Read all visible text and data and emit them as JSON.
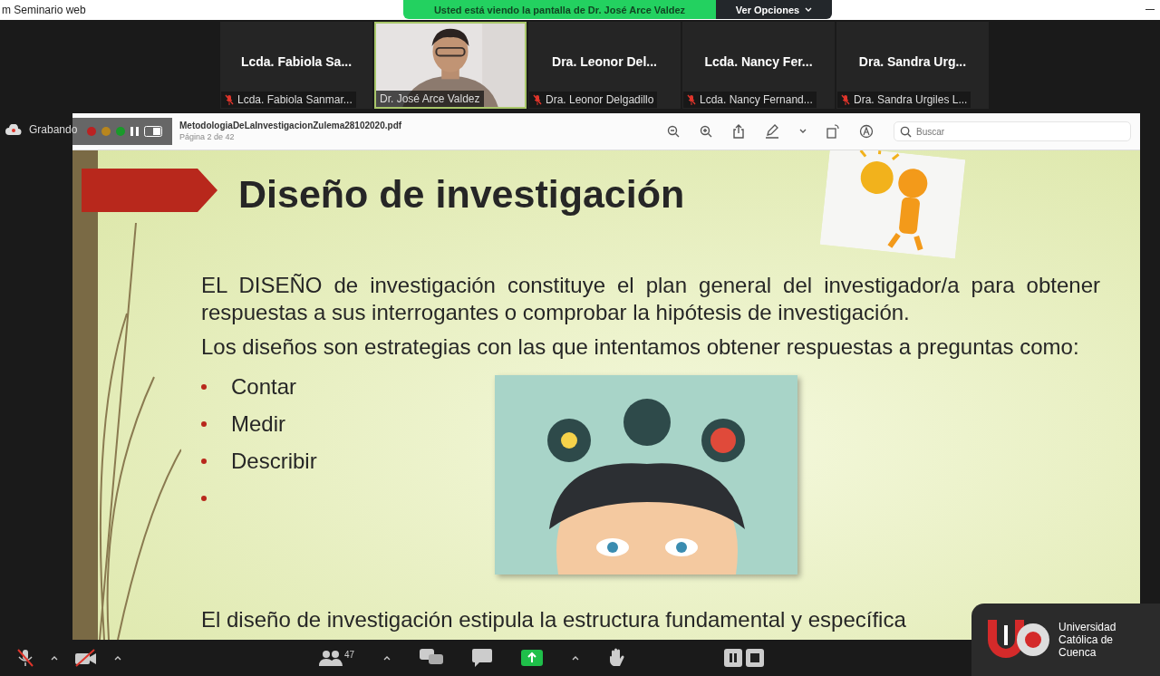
{
  "window": {
    "title": "m Seminario web"
  },
  "share_banner": {
    "text": "Usted está viendo la pantalla de Dr. José Arce Valdez",
    "options_button": "Ver Opciones"
  },
  "participants": [
    {
      "kind": "name",
      "display": "Lcda. Fabiola Sa...",
      "label": "Lcda. Fabiola Sanmar...",
      "muted": true,
      "speaking": false
    },
    {
      "kind": "video",
      "label": "Dr. José Arce Valdez",
      "muted": false,
      "speaking": true
    },
    {
      "kind": "name",
      "display": "Dra. Leonor Del...",
      "label": "Dra. Leonor Delgadillo",
      "muted": true,
      "speaking": false
    },
    {
      "kind": "name",
      "display": "Lcda. Nancy Fer...",
      "label": "Lcda. Nancy Fernand...",
      "muted": true,
      "speaking": false
    },
    {
      "kind": "name",
      "display": "Dra. Sandra Urg...",
      "label": "Dra. Sandra Urgiles L...",
      "muted": true,
      "speaking": false
    }
  ],
  "recording": {
    "label": "Grabando"
  },
  "pdf_viewer": {
    "filename": "MetodologiaDeLaInvestigacionZulema28102020.pdf",
    "page": "Página 2 de 42",
    "search": {
      "placeholder": "Buscar"
    }
  },
  "slide": {
    "title": "Diseño de investigación",
    "paragraphs": [
      "EL DISEÑO de investigación constituye el plan general del investigador/a para obtener respuestas a sus interrogantes o comprobar la hipótesis de investigación.",
      "Los diseños son estrategias con las que intentamos obtener respuestas a preguntas como:"
    ],
    "bullets": [
      {
        "kind": "text",
        "text": "Contar"
      },
      {
        "kind": "text",
        "text": "Medir"
      },
      {
        "kind": "text",
        "text": "Describir"
      },
      {
        "kind": "empty"
      }
    ],
    "footer_text": "El diseño de investigación estipula la estructura fundamental y específica"
  },
  "toolbar": {
    "participants_count": "47"
  },
  "logo": {
    "name": "Universidad Católica de Cuenca"
  }
}
